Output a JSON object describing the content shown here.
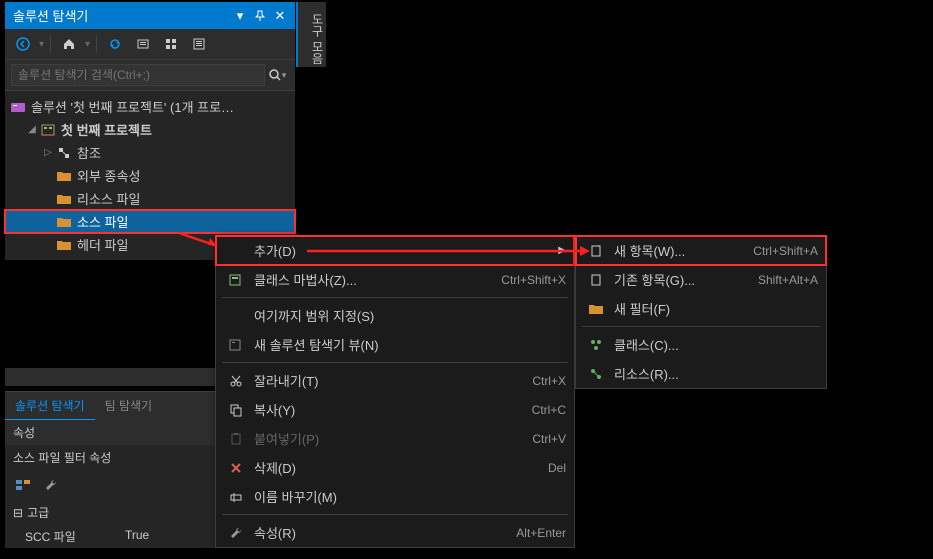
{
  "panel": {
    "title": "솔루션 탐색기",
    "search_placeholder": "솔루션 탐색기 검색(Ctrl+;)"
  },
  "side_strip": "도구 모음",
  "tree": {
    "solution": "솔루션 '첫 번째 프로젝트' (1개 프로…",
    "project": "첫 번째 프로젝트",
    "refs": "참조",
    "ext_deps": "외부 종속성",
    "resource": "리소스 파일",
    "source": "소스 파일",
    "header": "헤더 파일"
  },
  "tabs": {
    "solution_explorer": "솔루션 탐색기",
    "team_explorer": "팀 탐색기"
  },
  "props": {
    "title": "속성",
    "subtitle": "소스 파일 필터 속성",
    "category": "고급",
    "row1_key": "SCC 파일",
    "row1_val": "True"
  },
  "menu1": {
    "add": "추가(D)",
    "class_wizard": "클래스 마법사(Z)...",
    "class_wizard_sc": "Ctrl+Shift+X",
    "scope": "여기까지 범위 지정(S)",
    "new_view": "새 솔루션 탐색기 뷰(N)",
    "cut": "잘라내기(T)",
    "cut_sc": "Ctrl+X",
    "copy": "복사(Y)",
    "copy_sc": "Ctrl+C",
    "paste": "붙여넣기(P)",
    "paste_sc": "Ctrl+V",
    "delete": "삭제(D)",
    "delete_sc": "Del",
    "rename": "이름 바꾸기(M)",
    "properties": "속성(R)",
    "properties_sc": "Alt+Enter"
  },
  "menu2": {
    "new_item": "새 항목(W)...",
    "new_item_sc": "Ctrl+Shift+A",
    "existing_item": "기존 항목(G)...",
    "existing_item_sc": "Shift+Alt+A",
    "new_filter": "새 필터(F)",
    "class": "클래스(C)...",
    "resource": "리소스(R)..."
  }
}
